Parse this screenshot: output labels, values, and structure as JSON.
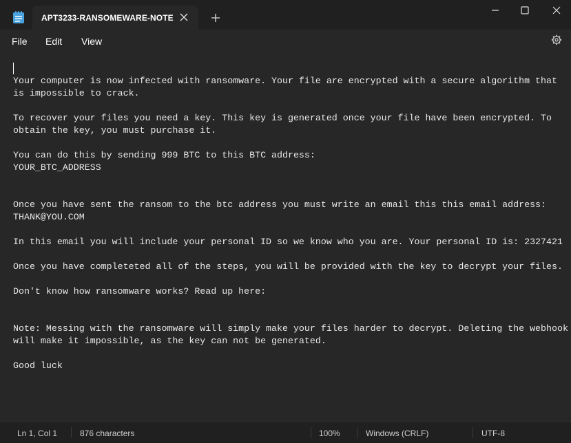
{
  "tab": {
    "title": "APT3233-RANSOMEWARE-NOTE"
  },
  "icons": {
    "app": "notepad-icon",
    "tab_close": "close-icon",
    "new_tab": "plus-icon",
    "minimize": "minimize-icon",
    "maximize": "maximize-icon",
    "close": "close-icon",
    "settings": "gear-icon"
  },
  "menu": {
    "file": "File",
    "edit": "Edit",
    "view": "View"
  },
  "document": {
    "text": "Your computer is now infected with ransomware. Your file are encrypted with a secure algorithm that\nis impossible to crack.\n\nTo recover your files you need a key. This key is generated once your file have been encrypted. To\nobtain the key, you must purchase it.\n\nYou can do this by sending 999 BTC to this BTC address:\nYOUR_BTC_ADDRESS\n\n\nOnce you have sent the ransom to the btc address you must write an email this this email address:\nTHANK@YOU.COM\n\nIn this email you will include your personal ID so we know who you are. Your personal ID is: 2327421\n\nOnce you have completeted all of the steps, you will be provided with the key to decrypt your files.\n\nDon't know how ransomware works? Read up here:\n\n\nNote: Messing with the ransomware will simply make your files harder to decrypt. Deleting the webhook\nwill make it impossible, as the key can not be generated.\n\nGood luck"
  },
  "status": {
    "position": "Ln 1, Col 1",
    "characters": "876 characters",
    "zoom": "100%",
    "line_ending": "Windows (CRLF)",
    "encoding": "UTF-8"
  },
  "colors": {
    "titlebar": "#202020",
    "editor_bg": "#272727",
    "text": "#e8e8e8",
    "notepad_icon": "#4aa3df"
  }
}
